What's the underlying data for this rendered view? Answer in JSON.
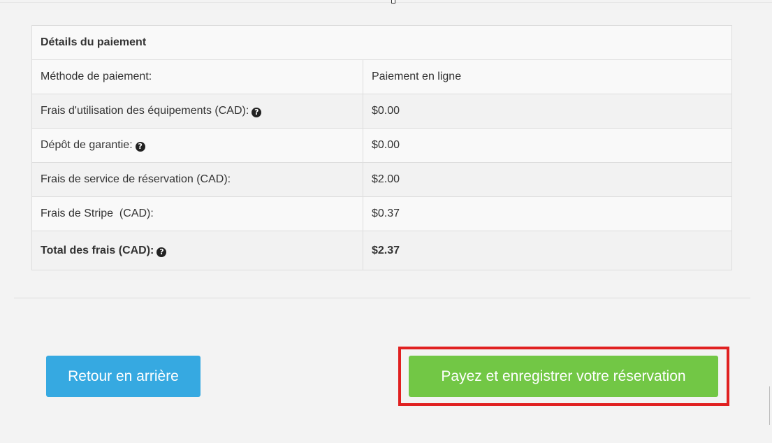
{
  "payment_details": {
    "header": "Détails du paiement",
    "rows": [
      {
        "label": "Méthode de paiement:",
        "value": "Paiement en ligne",
        "has_help": false
      },
      {
        "label": "Frais d'utilisation des équipements (CAD):",
        "value": "$0.00",
        "has_help": true
      },
      {
        "label": "Dépôt de garantie:",
        "value": "$0.00",
        "has_help": true
      },
      {
        "label": "Frais de service de réservation (CAD):",
        "value": "$2.00",
        "has_help": false
      },
      {
        "label": "Frais de Stripe  (CAD):",
        "value": "$0.37",
        "has_help": false
      }
    ],
    "total": {
      "label": "Total des frais (CAD):",
      "value": "$2.37",
      "has_help": true
    }
  },
  "actions": {
    "back_label": "Retour en arrière",
    "pay_label": "Payez et enregistrer votre réservation"
  },
  "icons": {
    "help": "question-circle-icon"
  },
  "colors": {
    "back_button": "#36a9e1",
    "pay_button": "#72c745",
    "highlight": "#e02020"
  }
}
